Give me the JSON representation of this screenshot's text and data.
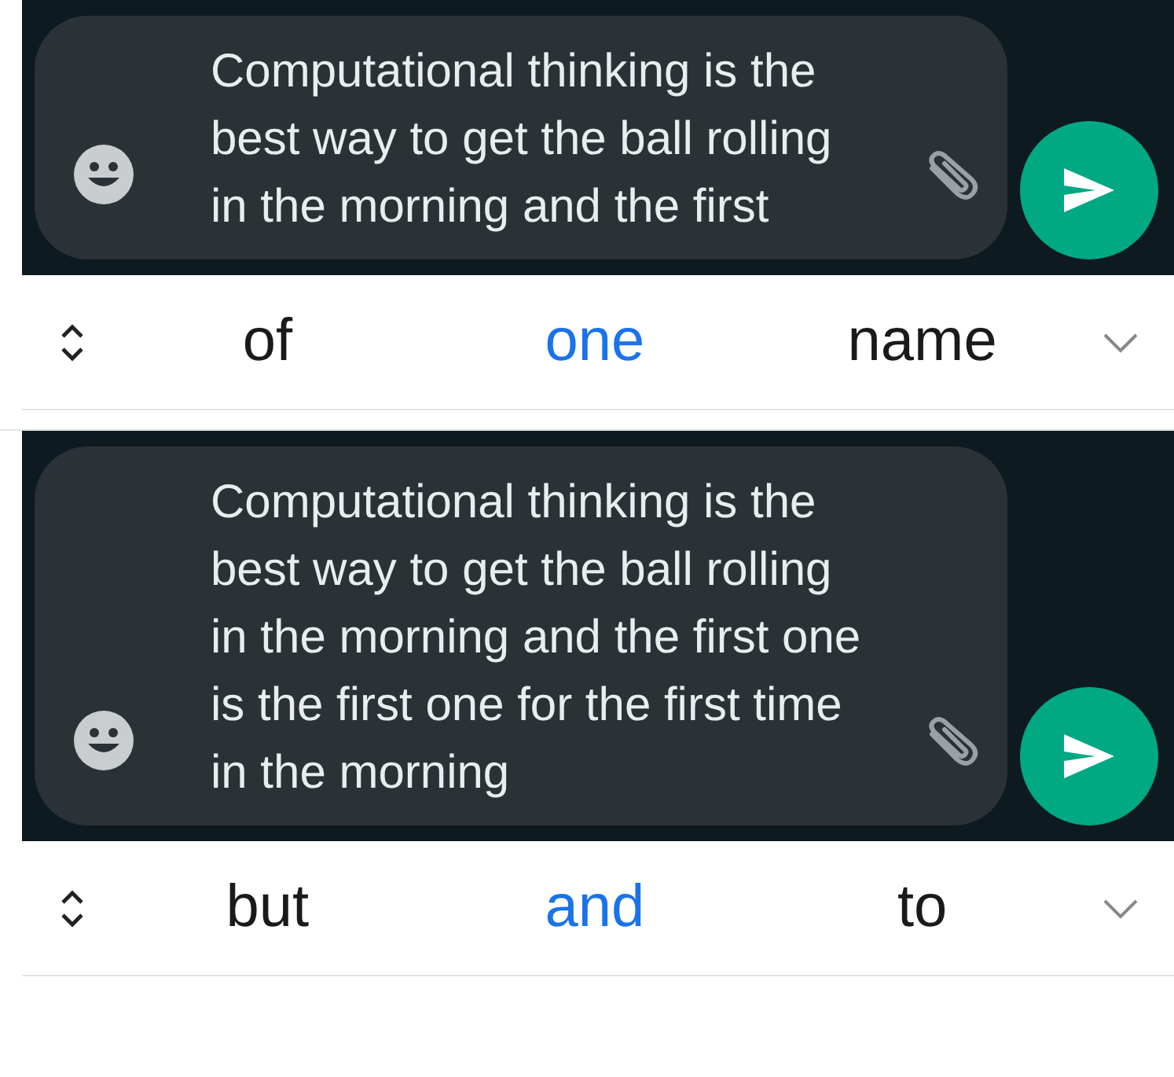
{
  "panels": [
    {
      "message": "Computational thinking is the best way to get the ball rolling in the morning and the first",
      "suggestions": [
        {
          "text": "of",
          "selected": false
        },
        {
          "text": "one",
          "selected": true
        },
        {
          "text": "name",
          "selected": false
        }
      ]
    },
    {
      "message": "Computational thinking is the best way to get the ball rolling in the morning and the first one is the first one for the first time in the morning",
      "suggestions": [
        {
          "text": "but",
          "selected": false
        },
        {
          "text": "and",
          "selected": true
        },
        {
          "text": "to",
          "selected": false
        }
      ]
    }
  ]
}
